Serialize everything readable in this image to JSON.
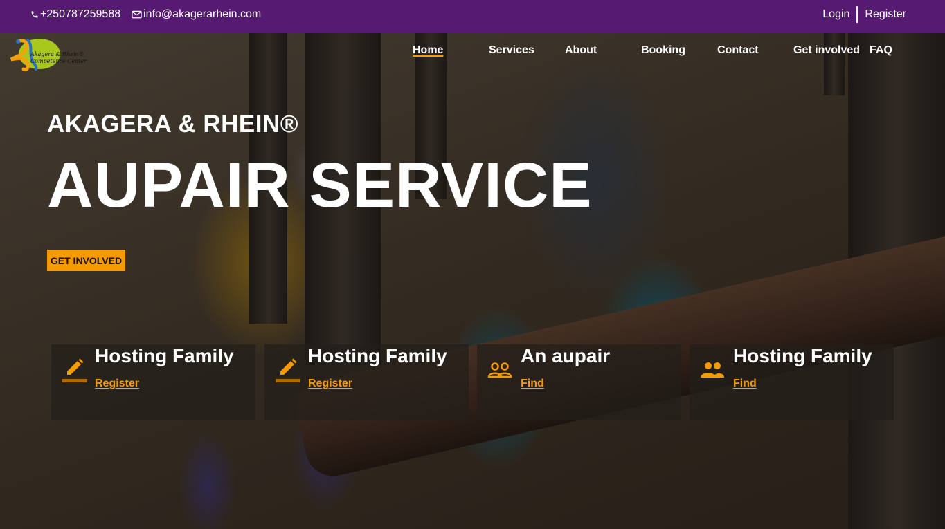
{
  "topbar": {
    "phone": "+250787259588",
    "email": "info@akagerarhein.com",
    "login_label": "Login",
    "register_label": "Register"
  },
  "logo": {
    "text_line1": "Akagera & Rhein®",
    "text_line2": "Competence Center"
  },
  "nav": {
    "items": [
      {
        "label": "Home",
        "active": true
      },
      {
        "label": "Services"
      },
      {
        "label": "About"
      },
      {
        "label": "Booking"
      },
      {
        "label": "Contact"
      },
      {
        "label": "Get involved"
      },
      {
        "label": "FAQ"
      }
    ]
  },
  "hero": {
    "brand": "AKAGERA & RHEIN®",
    "headline": "AUPAIR SERVICE",
    "cta_label": "GET INVOLVED"
  },
  "cards": [
    {
      "title": "Hosting Family",
      "link": "Register",
      "icon": "pencil-icon"
    },
    {
      "title": "Hosting Family",
      "link": "Register",
      "icon": "pencil-icon"
    },
    {
      "title": "An aupair",
      "link": "Find",
      "icon": "people-outline-icon"
    },
    {
      "title": "Hosting Family",
      "link": "Find",
      "icon": "people-filled-icon"
    }
  ],
  "colors": {
    "topbar": "#571a73",
    "accent": "#f59a00"
  }
}
